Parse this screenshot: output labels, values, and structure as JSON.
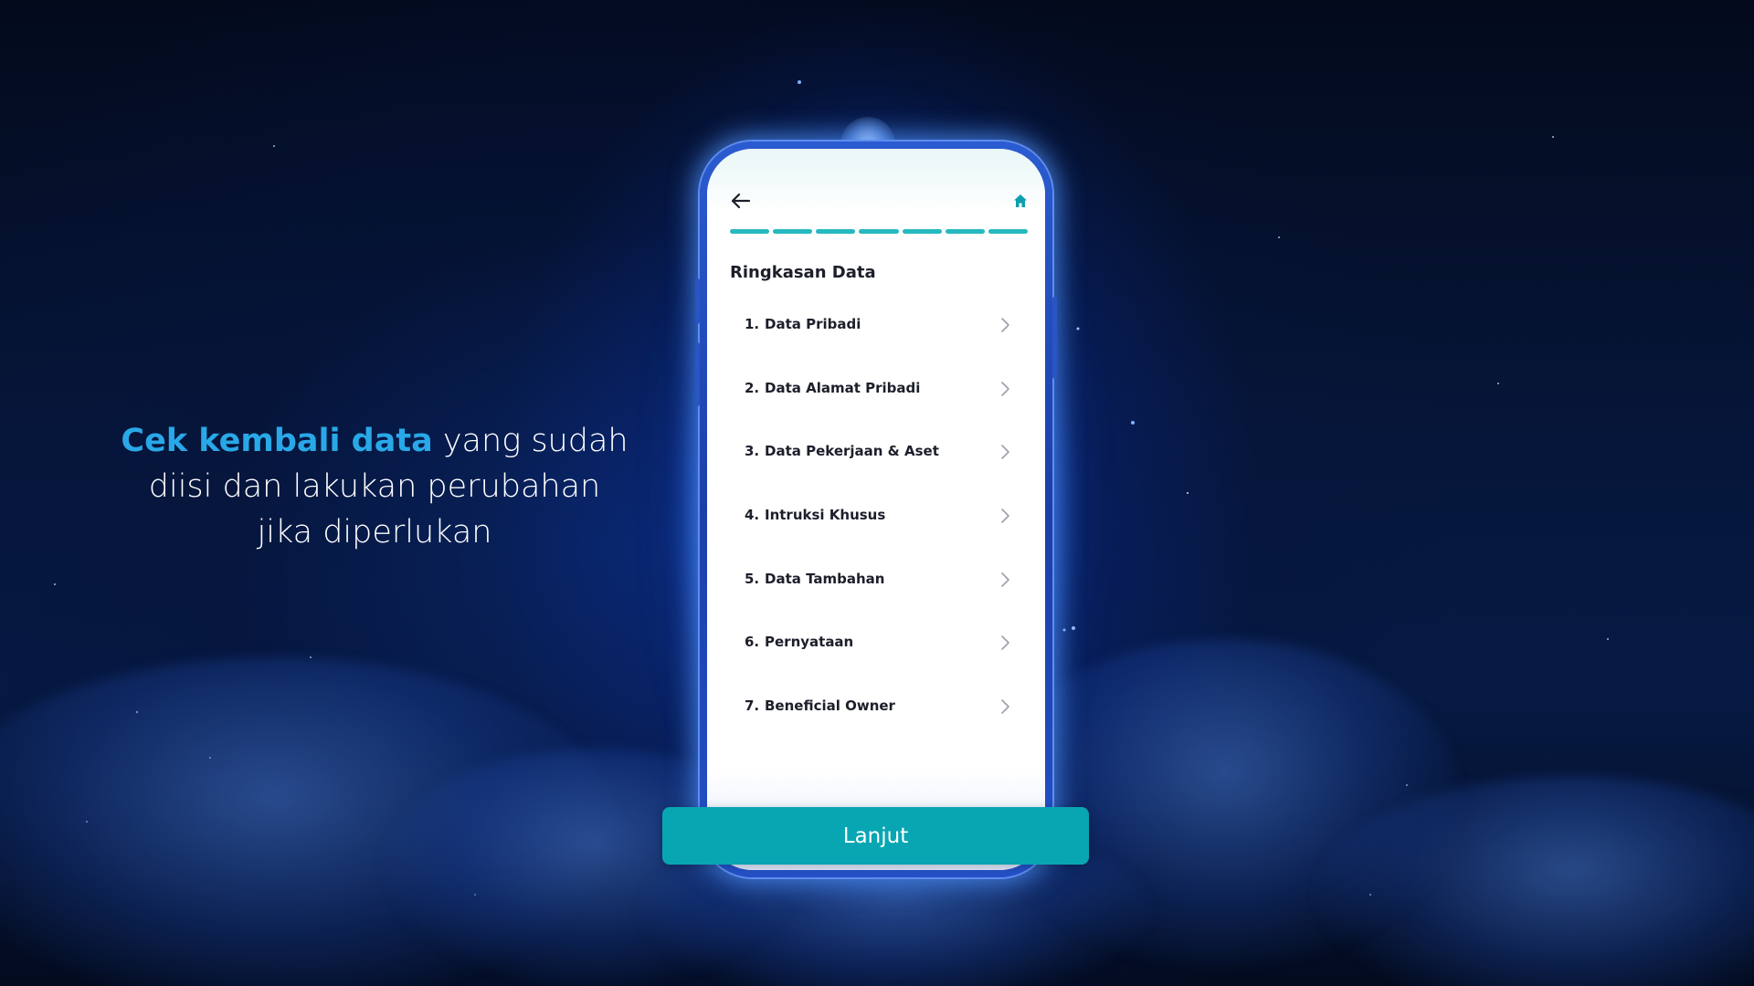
{
  "tagline": {
    "highlight": "Cek kembali data",
    "rest_line1": " yang sudah",
    "line2": "diisi dan lakukan perubahan",
    "line3": "jika diperlukan"
  },
  "app": {
    "back_icon": "arrow-left-icon",
    "home_icon": "home-icon",
    "progress": {
      "total_steps": 7,
      "completed_steps": 7,
      "color": "#26b9bf"
    },
    "section_title": "Ringkasan Data",
    "items": [
      {
        "number": "1.",
        "label": "Data Pribadi"
      },
      {
        "number": "2.",
        "label": "Data Alamat Pribadi"
      },
      {
        "number": "3.",
        "label": "Data Pekerjaan & Aset"
      },
      {
        "number": "4.",
        "label": "Intruksi Khusus"
      },
      {
        "number": "5.",
        "label": "Data Tambahan"
      },
      {
        "number": "6.",
        "label": "Pernyataan"
      },
      {
        "number": "7.",
        "label": "Beneficial Owner"
      }
    ],
    "continue_button": "Lanjut"
  },
  "colors": {
    "accent": "#08a6b3",
    "highlight_text": "#29a8e8",
    "background": "#06163a"
  }
}
